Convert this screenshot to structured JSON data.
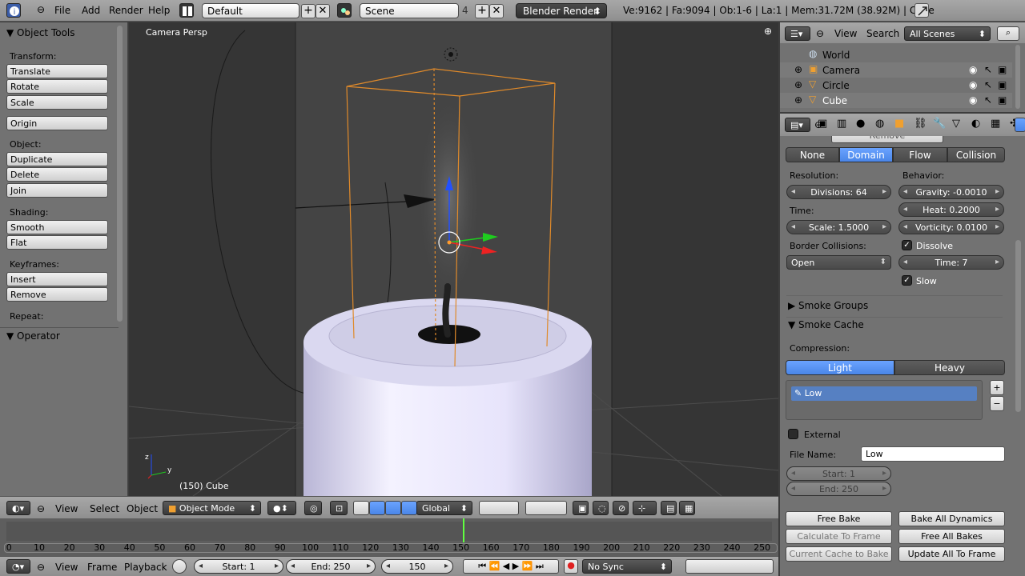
{
  "topbar": {
    "menus": [
      "File",
      "Add",
      "Render",
      "Help"
    ],
    "layout": "Default",
    "scene": "Scene",
    "scene_count": "4",
    "render_engine": "Blender Render",
    "stats": "Ve:9162 | Fa:9094 | Ob:1-6 | La:1 | Mem:31.72M (38.92M) | Cube"
  },
  "toolshelf": {
    "title": "Object Tools",
    "transform_label": "Transform:",
    "translate": "Translate",
    "rotate": "Rotate",
    "scale": "Scale",
    "origin": "Origin",
    "object_label": "Object:",
    "duplicate": "Duplicate",
    "delete": "Delete",
    "join": "Join",
    "shading_label": "Shading:",
    "smooth": "Smooth",
    "flat": "Flat",
    "keyframes_label": "Keyframes:",
    "insert": "Insert",
    "remove": "Remove",
    "repeat_label": "Repeat:",
    "operator": "Operator"
  },
  "viewport": {
    "view_name": "Camera Persp",
    "object_info": "(150) Cube"
  },
  "vp_header": {
    "view": "View",
    "select": "Select",
    "object": "Object",
    "mode": "Object Mode",
    "orientation": "Global"
  },
  "timeline": {
    "ticks": [
      "0",
      "10",
      "20",
      "30",
      "40",
      "50",
      "60",
      "70",
      "80",
      "90",
      "100",
      "110",
      "120",
      "130",
      "140",
      "150",
      "160",
      "170",
      "180",
      "190",
      "200",
      "210",
      "220",
      "230",
      "240",
      "250"
    ],
    "view": "View",
    "frame": "Frame",
    "playback": "Playback",
    "start": "Start: 1",
    "end": "End: 250",
    "current": "150",
    "sync": "No Sync"
  },
  "outliner": {
    "view": "View",
    "search": "Search",
    "filter": "All Scenes",
    "rows": [
      "World",
      "Camera",
      "Circle",
      "Cube"
    ]
  },
  "properties": {
    "remove_partial": "Remove",
    "type_tabs": [
      "None",
      "Domain",
      "Flow",
      "Collision"
    ],
    "resolution_label": "Resolution:",
    "behavior_label": "Behavior:",
    "divisions": "Divisions: 64",
    "gravity": "Gravity: -0.0010",
    "time_label": "Time:",
    "heat": "Heat: 0.2000",
    "scale": "Scale: 1.5000",
    "vorticity": "Vorticity: 0.0100",
    "border_label": "Border Collisions:",
    "dissolve": "Dissolve",
    "border_value": "Open",
    "time_value": "Time: 7",
    "slow": "Slow",
    "smoke_groups": "Smoke Groups",
    "smoke_cache": "Smoke Cache",
    "compression_label": "Compression:",
    "compression_tabs": [
      "Light",
      "Heavy"
    ],
    "cache_item": "Low",
    "external": "External",
    "file_name_label": "File Name:",
    "file_name": "Low",
    "cache_start": "Start: 1",
    "cache_end": "End: 250",
    "free_bake": "Free Bake",
    "bake_all": "Bake All Dynamics",
    "calc_to_frame": "Calculate To Frame",
    "free_all": "Free All Bakes",
    "current_cache": "Current Cache to Bake",
    "update_all": "Update All To Frame"
  }
}
